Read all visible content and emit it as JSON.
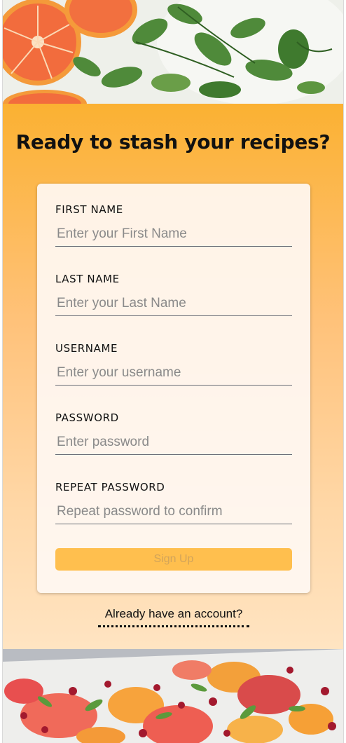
{
  "header": {
    "title": "Ready to stash your recipes?"
  },
  "form": {
    "fields": [
      {
        "label": "FIRST NAME",
        "placeholder": "Enter your First Name"
      },
      {
        "label": "LAST NAME",
        "placeholder": "Enter your Last Name"
      },
      {
        "label": "USERNAME",
        "placeholder": "Enter your username"
      },
      {
        "label": "PASSWORD",
        "placeholder": "Enter password"
      },
      {
        "label": "REPEAT PASSWORD",
        "placeholder": "Repeat password to confirm"
      }
    ],
    "submit_label": "Sign Up"
  },
  "footer": {
    "login_link": "Already have an account?"
  },
  "colors": {
    "gradient_top": "#fbb132",
    "gradient_bottom": "#ffe4c2",
    "button": "#ffbf4e",
    "button_text": "#d2a45a"
  },
  "images": {
    "top": "oranges-and-mint-photo",
    "bottom": "citrus-salad-photo"
  }
}
